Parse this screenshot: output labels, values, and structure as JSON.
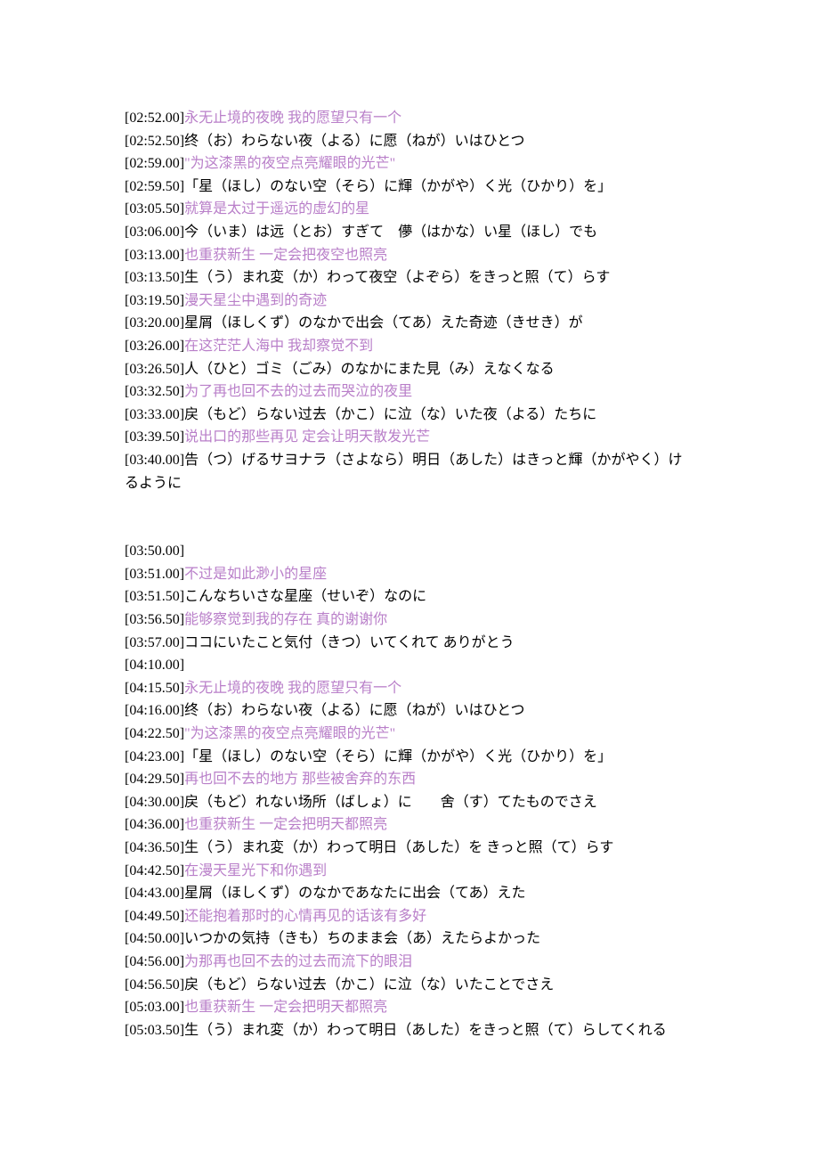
{
  "lines": [
    {
      "ts": "[02:52.00]",
      "type": "cn",
      "text": "永无止境的夜晚 我的愿望只有一个"
    },
    {
      "ts": "[02:52.50]",
      "type": "jp",
      "text": "终（お）わらない夜（よる）に愿（ねが）いはひとつ"
    },
    {
      "ts": "[02:59.00]",
      "type": "cn",
      "text": "\"为这漆黑的夜空点亮耀眼的光芒\""
    },
    {
      "ts": "[02:59.50]",
      "type": "jp",
      "text": "「星（ほし）のない空（そら）に輝（かがや）く光（ひかり）を」"
    },
    {
      "ts": "[03:05.50]",
      "type": "cn",
      "text": "就算是太过于遥远的虚幻的星"
    },
    {
      "ts": "[03:06.00]",
      "type": "jp",
      "text": "今（いま）は远（とお）すぎて　儚（はかな）い星（ほし）でも"
    },
    {
      "ts": "[03:13.00]",
      "type": "cn",
      "text": "也重获新生 一定会把夜空也照亮"
    },
    {
      "ts": "[03:13.50]",
      "type": "jp",
      "text": "生（う）まれ変（か）わって夜空（よぞら）をきっと照（て）らす"
    },
    {
      "ts": "[03:19.50]",
      "type": "cn",
      "text": "漫天星尘中遇到的奇迹"
    },
    {
      "ts": "[03:20.00]",
      "type": "jp",
      "text": "星屑（ほしくず）のなかで出会（てあ）えた奇迹（きせき）が"
    },
    {
      "ts": "[03:26.00]",
      "type": "cn",
      "text": "在这茫茫人海中 我却察觉不到"
    },
    {
      "ts": "[03:26.50]",
      "type": "jp",
      "text": "人（ひと）ゴミ（ごみ）のなかにまた見（み）えなくなる"
    },
    {
      "ts": "[03:32.50]",
      "type": "cn",
      "text": "为了再也回不去的过去而哭泣的夜里"
    },
    {
      "ts": "[03:33.00]",
      "type": "jp",
      "text": "戻（もど）らない过去（かこ）に泣（な）いた夜（よる）たちに"
    },
    {
      "ts": "[03:39.50]",
      "type": "cn",
      "text": "说出口的那些再见 定会让明天散发光芒"
    },
    {
      "ts": "[03:40.00]",
      "type": "jp",
      "text": "告（つ）げるサヨナラ（さよなら）明日（あした）はきっと輝（かがやく）けるように"
    },
    {
      "type": "blank"
    },
    {
      "type": "blank"
    },
    {
      "ts": "[03:50.00]",
      "type": "jp",
      "text": ""
    },
    {
      "ts": "[03:51.00]",
      "type": "cn",
      "text": "不过是如此渺小的星座"
    },
    {
      "ts": "[03:51.50]",
      "type": "jp",
      "text": "こんなちいさな星座（せいぞ）なのに"
    },
    {
      "ts": "[03:56.50]",
      "type": "cn",
      "text": "能够察觉到我的存在 真的谢谢你"
    },
    {
      "ts": "[03:57.00]",
      "type": "jp",
      "text": "ココにいたこと気付（きつ）いてくれて ありがとう"
    },
    {
      "ts": "[04:10.00]",
      "type": "jp",
      "text": ""
    },
    {
      "ts": "[04:15.50]",
      "type": "cn",
      "text": "永无止境的夜晚 我的愿望只有一个"
    },
    {
      "ts": "[04:16.00]",
      "type": "jp",
      "text": "终（お）わらない夜（よる）に愿（ねが）いはひとつ"
    },
    {
      "ts": "[04:22.50]",
      "type": "cn",
      "text": "\"为这漆黑的夜空点亮耀眼的光芒\""
    },
    {
      "ts": "[04:23.00]",
      "type": "jp",
      "text": "「星（ほし）のない空（そら）に輝（かがや）く光（ひかり）を」"
    },
    {
      "ts": "[04:29.50]",
      "type": "cn",
      "text": "再也回不去的地方 那些被舍弃的东西"
    },
    {
      "ts": "[04:30.00]",
      "type": "jp",
      "text": "戻（もど）れない场所（ばしょ）に　　舍（す）てたものでさえ"
    },
    {
      "ts": "[04:36.00]",
      "type": "cn",
      "text": "也重获新生 一定会把明天都照亮"
    },
    {
      "ts": "[04:36.50]",
      "type": "jp",
      "text": "生（う）まれ変（か）わって明日（あした）を きっと照（て）らす"
    },
    {
      "ts": "[04:42.50]",
      "type": "cn",
      "text": "在漫天星光下和你遇到"
    },
    {
      "ts": "[04:43.00]",
      "type": "jp",
      "text": "星屑（ほしくず）のなかであなたに出会（てあ）えた"
    },
    {
      "ts": "[04:49.50]",
      "type": "cn",
      "text": "还能抱着那时的心情再见的话该有多好"
    },
    {
      "ts": "[04:50.00]",
      "type": "jp",
      "text": "いつかの気持（きも）ちのまま会（あ）えたらよかった"
    },
    {
      "ts": "[04:56.00]",
      "type": "cn",
      "text": "为那再也回不去的过去而流下的眼泪"
    },
    {
      "ts": "[04:56.50]",
      "type": "jp",
      "text": "戻（もど）らない过去（かこ）に泣（な）いたことでさえ"
    },
    {
      "ts": "[05:03.00]",
      "type": "cn",
      "text": "也重获新生 一定会把明天都照亮"
    },
    {
      "ts": "[05:03.50]",
      "type": "jp",
      "text": "生（う）まれ変（か）わって明日（あした）をきっと照（て）らしてくれる"
    }
  ]
}
